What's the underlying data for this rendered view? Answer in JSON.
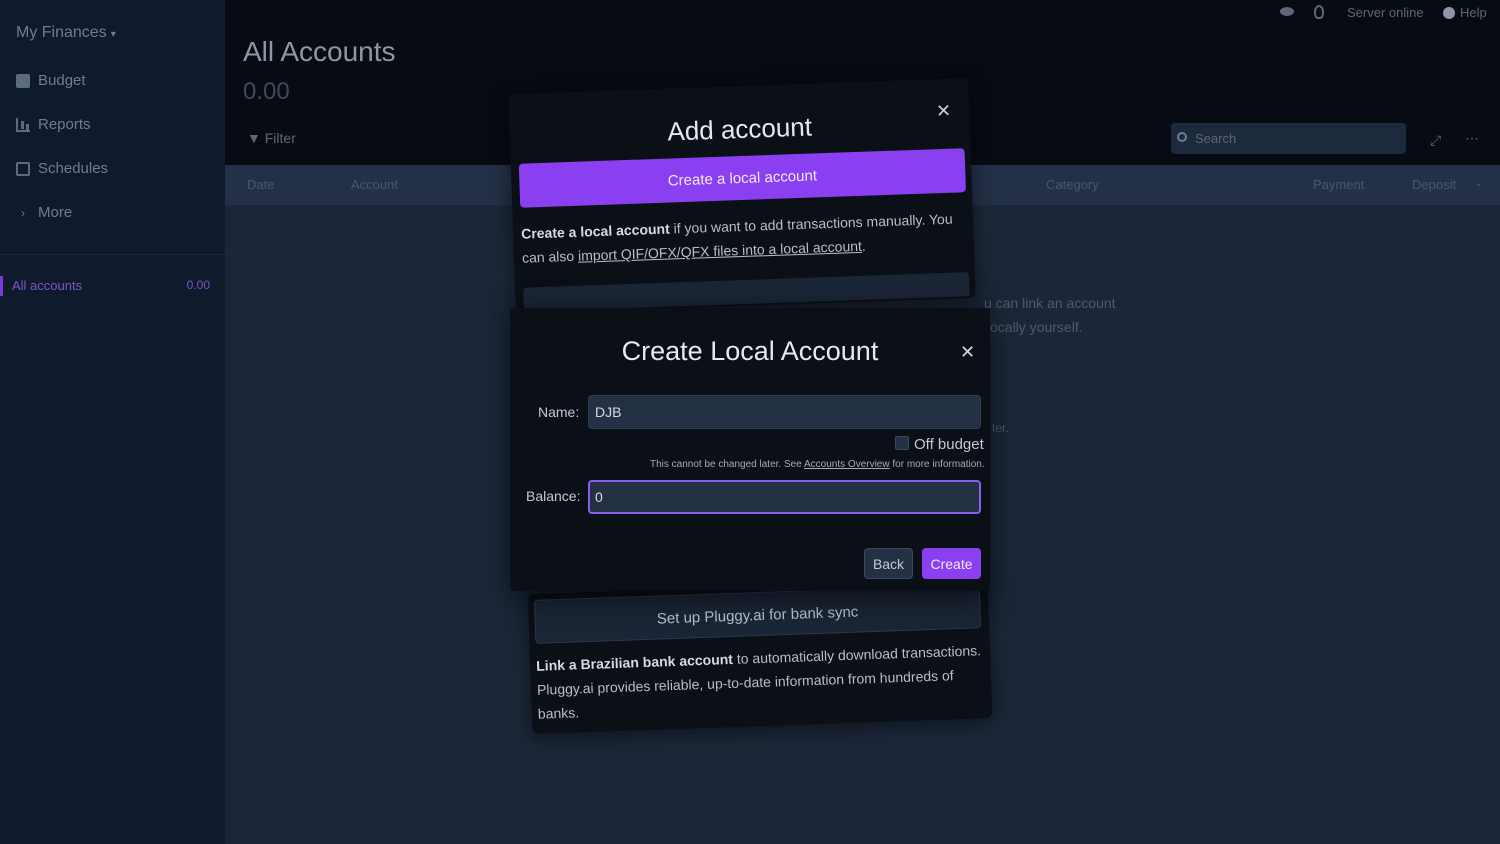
{
  "sidebar": {
    "brand": "My Finances",
    "items": [
      {
        "label": "Budget"
      },
      {
        "label": "Reports"
      },
      {
        "label": "Schedules"
      },
      {
        "label": "More"
      }
    ],
    "account": {
      "label": "All accounts",
      "balance": "0.00"
    }
  },
  "topbar": {
    "server_status": "Server online",
    "help": "Help"
  },
  "page": {
    "title": "All Accounts",
    "balance": "0.00",
    "filter": "Filter",
    "search_placeholder": "Search"
  },
  "table": {
    "columns": [
      "Date",
      "Account",
      "Category",
      "Payment",
      "Deposit"
    ]
  },
  "background": {
    "line1": "u can link an account",
    "line2": "ocally yourself.",
    "line3": "ter."
  },
  "add_account": {
    "title": "Add account",
    "local_button": "Create a local account",
    "desc_bold": "Create a local account",
    "desc_text": " if you want to add transactions manually. You can also ",
    "desc_link": "import QIF/OFX/QFX files into a local account",
    "desc_end": "."
  },
  "pluggy": {
    "button": "Set up Pluggy.ai for bank sync",
    "desc_bold": "Link a Brazilian bank account",
    "desc_text": " to automatically download transactions. Pluggy.ai provides reliable, up-to-date information from hundreds of banks."
  },
  "create_local": {
    "title": "Create Local Account",
    "name_label": "Name:",
    "name_value": "DJB",
    "off_budget_label": "Off budget",
    "hint_prefix": "This cannot be changed later. See ",
    "hint_link": "Accounts Overview",
    "hint_suffix": " for more information.",
    "balance_label": "Balance:",
    "balance_value": "0",
    "back_label": "Back",
    "create_label": "Create"
  }
}
